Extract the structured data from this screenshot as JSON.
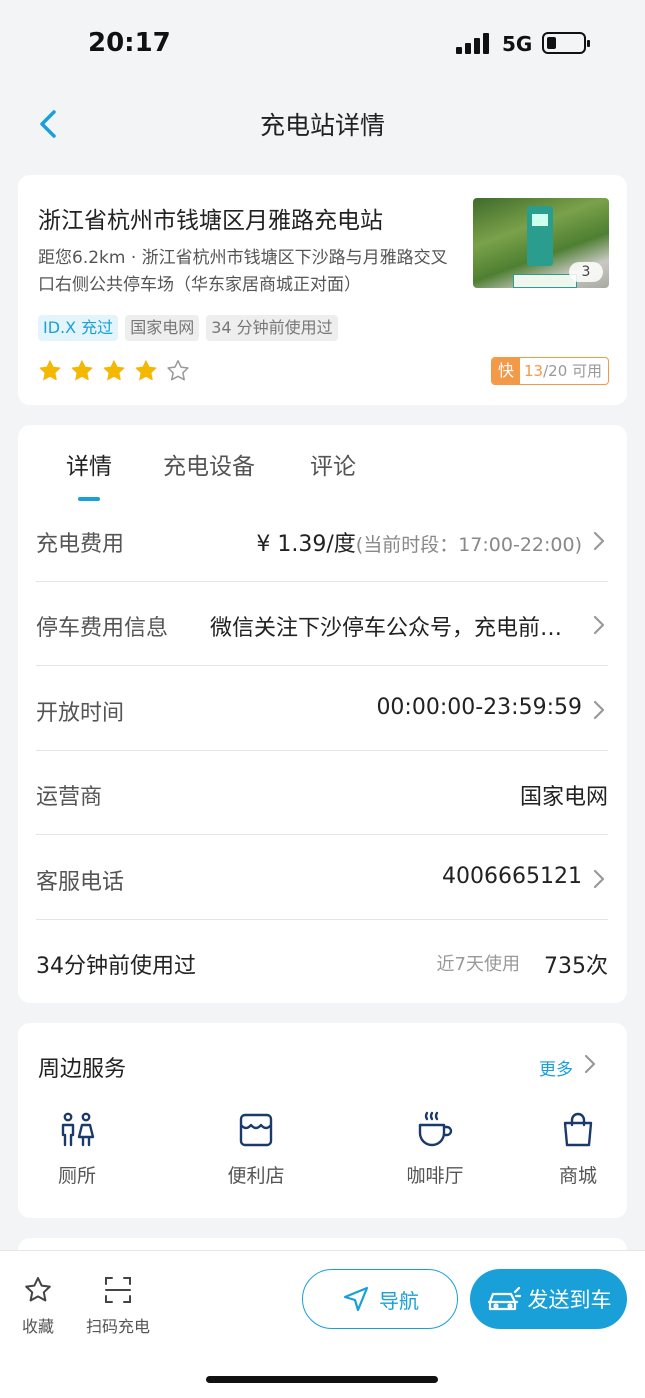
{
  "status_bar": {
    "time": "20:17",
    "network": "5G"
  },
  "header": {
    "title": "充电站详情"
  },
  "station": {
    "name": "浙江省杭州市钱塘区月雅路充电站",
    "address": "距您6.2km · 浙江省杭州市钱塘区下沙路与月雅路交叉口右侧公共停车场（华东家居商城正对面）",
    "photo_count": "3",
    "tags": [
      "ID.X 充过",
      "国家电网",
      "34 分钟前使用过"
    ],
    "rating": 4,
    "rating_max": 5,
    "fast_label": "快",
    "available_num": "13",
    "available_total": "/20 可用"
  },
  "tabs": [
    "详情",
    "充电设备",
    "评论"
  ],
  "details": {
    "fee_label": "充电费用",
    "fee_value": "¥ 1.39/度",
    "fee_period": "(当前时段：17:00-22:00)",
    "parking_label": "停车费用信息",
    "parking_value": "微信关注下沙停车公众号，充电前…",
    "hours_label": "开放时间",
    "hours_value": "00:00:00-23:59:59",
    "operator_label": "运营商",
    "operator_value": "国家电网",
    "phone_label": "客服电话",
    "phone_value": "4006665121",
    "used_label": "34分钟前使用过",
    "used_note": "近7天使用",
    "used_value": "735次"
  },
  "services": {
    "title": "周边服务",
    "more": "更多",
    "items": [
      {
        "label": "厕所",
        "icon": "toilet-icon"
      },
      {
        "label": "便利店",
        "icon": "store-icon"
      },
      {
        "label": "咖啡厅",
        "icon": "coffee-icon"
      },
      {
        "label": "商城",
        "icon": "shopping-bag-icon"
      }
    ]
  },
  "bottom_bar": {
    "favorite": "收藏",
    "scan": "扫码充电",
    "navigate": "导航",
    "send_to_car": "发送到车"
  },
  "colors": {
    "accent": "#1aa0d8",
    "star": "#f5b800",
    "fast": "#f39a49"
  }
}
